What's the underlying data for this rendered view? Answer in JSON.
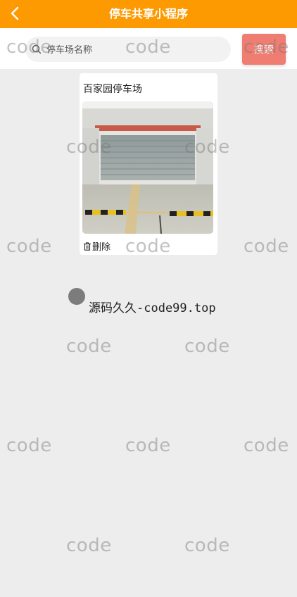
{
  "header": {
    "title": "停车共享小程序",
    "back_icon": "chevron-left-icon",
    "background": "#fd9a02"
  },
  "search": {
    "placeholder": "停车场名称",
    "button_label": "搜索"
  },
  "card": {
    "title": "百家园停车场",
    "delete_label": "删除"
  },
  "credit": {
    "text": "源码久久-code99.top"
  },
  "watermark": {
    "text": "code"
  }
}
